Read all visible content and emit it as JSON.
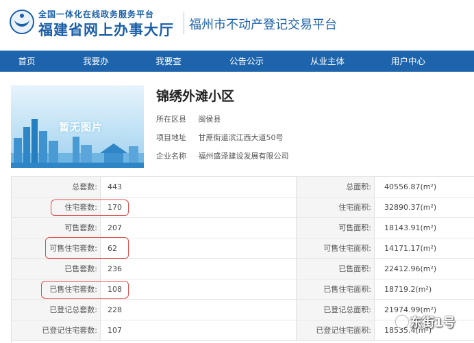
{
  "header": {
    "brand_top": "全国一体化在线政务服务平台",
    "brand_main": "福建省网上办事大厅",
    "platform_title": "福州市不动产登记交易平台"
  },
  "nav": {
    "items": [
      {
        "label": "首页"
      },
      {
        "label": "我要办"
      },
      {
        "label": "我要查"
      },
      {
        "label": "公告公示"
      },
      {
        "label": "从业主体"
      },
      {
        "label": "用户中心"
      }
    ]
  },
  "project": {
    "placeholder_image_text": "暂无图片",
    "name": "锦绣外滩小区",
    "district_label": "所在区县",
    "district_value": "闽侯县",
    "address_label": "项目地址",
    "address_value": "甘蔗街道滨江西大道50号",
    "company_label": "企业名称",
    "company_value": "福州盛泽建设发展有限公司"
  },
  "stats": {
    "rows": [
      {
        "label": "总套数:",
        "value": "443",
        "label2": "总面积:",
        "value2": "40556.87(m²)"
      },
      {
        "label": "住宅套数:",
        "value": "170",
        "label2": "住宅面积:",
        "value2": "32890.37(m²)"
      },
      {
        "label": "可售套数:",
        "value": "207",
        "label2": "可售面积:",
        "value2": "18143.91(m²)"
      },
      {
        "label": "可售住宅套数:",
        "value": "62",
        "label2": "可售住宅面积:",
        "value2": "14171.17(m²)"
      },
      {
        "label": "已售套数:",
        "value": "236",
        "label2": "已售面积:",
        "value2": "22412.96(m²)"
      },
      {
        "label": "已售住宅套数:",
        "value": "108",
        "label2": "已售住宅面积:",
        "value2": "18719.2(m²)"
      },
      {
        "label": "已登记总套数:",
        "value": "228",
        "label2": "已登记总面积:",
        "value2": "21974.99(m²)"
      },
      {
        "label": "已登记住宅套数:",
        "value": "107",
        "label2": "已登记住宅面积:",
        "value2": "18535.4(m²)"
      }
    ]
  },
  "watermark": {
    "text": "东街1号"
  },
  "colors": {
    "brand_blue": "#1a5fa8",
    "nav_blue": "#1e64ac",
    "highlight_red": "#e04a4a"
  }
}
